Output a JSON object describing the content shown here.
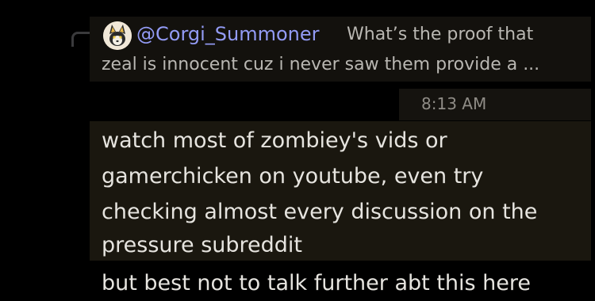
{
  "reply": {
    "author": "@Corgi_Summoner",
    "text_line1": "What’s the proof that",
    "text_line2": "zeal is innocent cuz i never saw them provide a ...",
    "avatar_icon": "corgi-avatar-icon"
  },
  "message": {
    "timestamp": "8:13 AM",
    "lines": [
      "watch most of zombiey's vids or",
      "gamerchicken on youtube, even try",
      "checking almost every discussion on the",
      "pressure subreddit"
    ]
  },
  "followup": {
    "text": "but best not to talk further abt this here"
  },
  "colors": {
    "background": "#000000",
    "author": "#939bf5",
    "reply_text": "#b9b7b2",
    "message_text": "#e6e4df",
    "timestamp": "#8f8c86"
  }
}
